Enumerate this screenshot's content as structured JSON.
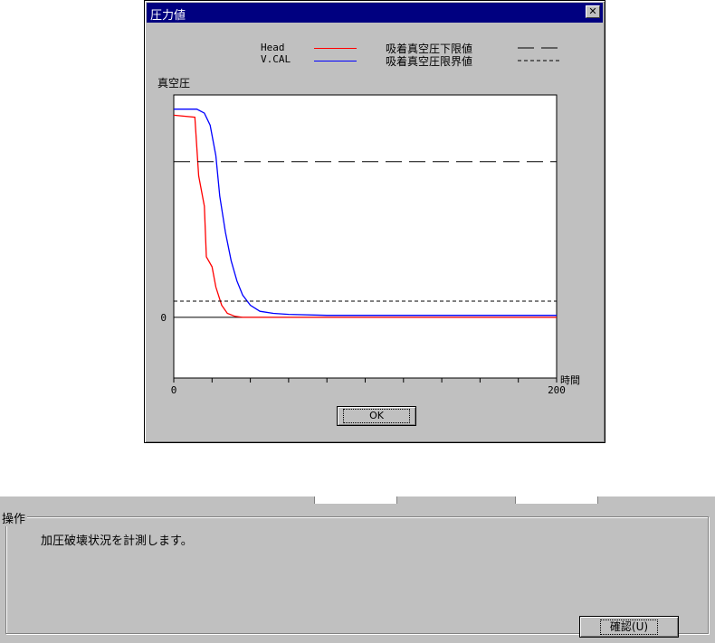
{
  "dialog": {
    "title": "圧力値",
    "close": "✕",
    "ok_label": "OK"
  },
  "legend": {
    "head": "Head",
    "vcal": "V.CAL",
    "lower": "吸着真空圧下限値",
    "limit": "吸着真空圧限界値"
  },
  "chart_data": {
    "type": "line",
    "ylabel": "真空圧",
    "xlabel": "時間",
    "x_ticks": [
      "0",
      "200"
    ],
    "y_ticks": [
      "0"
    ],
    "xlim": [
      0,
      200
    ],
    "ylim": [
      -30,
      110
    ],
    "series": [
      {
        "name": "Head",
        "color": "#ff0000",
        "x": [
          0,
          11,
          13,
          16,
          17,
          20,
          22,
          25,
          28,
          32,
          36,
          40,
          200
        ],
        "y": [
          100,
          99,
          70,
          55,
          30,
          25,
          15,
          6,
          2,
          0.5,
          0,
          0,
          0
        ]
      },
      {
        "name": "V.CAL",
        "color": "#0000ff",
        "x": [
          0,
          12,
          16,
          19,
          22,
          24,
          27,
          30,
          33,
          36,
          40,
          45,
          52,
          60,
          80,
          200
        ],
        "y": [
          103,
          103,
          101,
          95,
          80,
          60,
          42,
          28,
          18,
          11,
          6,
          3,
          2,
          1.5,
          1,
          1
        ]
      },
      {
        "name": "吸着真空圧下限値",
        "style": "long-dash",
        "x": [
          0,
          200
        ],
        "y": [
          77,
          77
        ]
      },
      {
        "name": "吸着真空圧限界値",
        "style": "short-dash",
        "x": [
          0,
          200
        ],
        "y": [
          8,
          8
        ]
      }
    ]
  },
  "operation": {
    "group_label": "操作",
    "message": "加圧破壊状況を計測します。",
    "confirm_label": "確認(U)"
  }
}
